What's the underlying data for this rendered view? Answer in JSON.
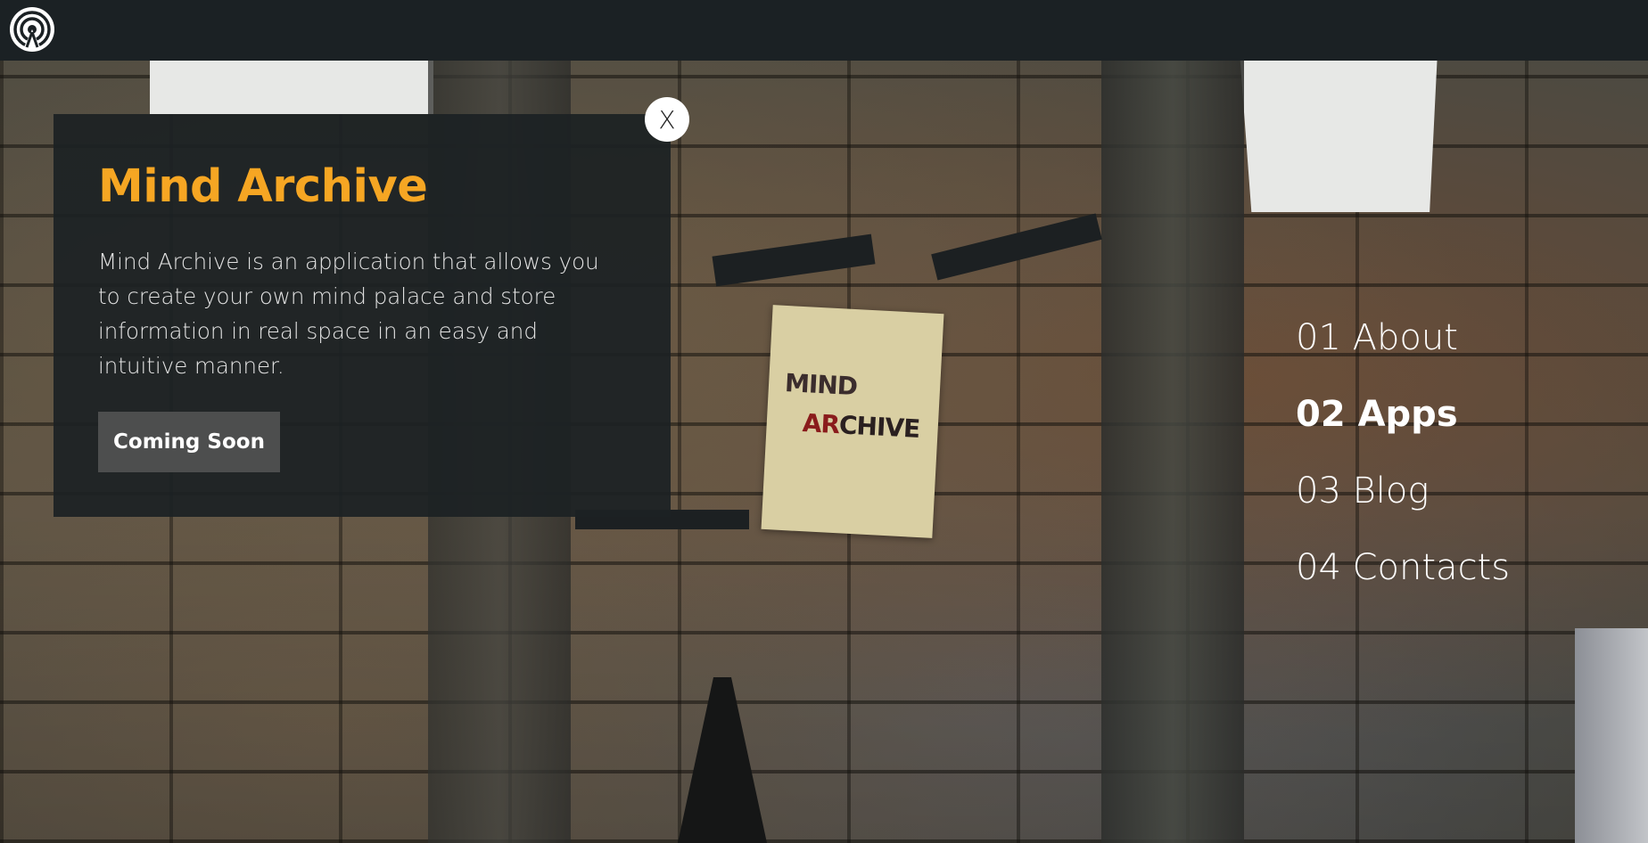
{
  "header": {
    "logo_icon": "radar-broadcast-icon"
  },
  "panel": {
    "title": "Mind Archive",
    "title_color": "#f6a623",
    "description": "Mind Archive is an application that allows you to create your own mind palace and store information in real space in an easy and intuitive manner.",
    "button_label": "Coming Soon",
    "close_label": "X"
  },
  "poster": {
    "line1": "MIND",
    "line2_accent": "AR",
    "line2_rest": "CHIVE"
  },
  "nav": {
    "items": [
      {
        "label": "01 About",
        "active": false
      },
      {
        "label": "02 Apps",
        "active": true
      },
      {
        "label": "03 Blog",
        "active": false
      },
      {
        "label": "04 Contacts",
        "active": false
      }
    ]
  }
}
